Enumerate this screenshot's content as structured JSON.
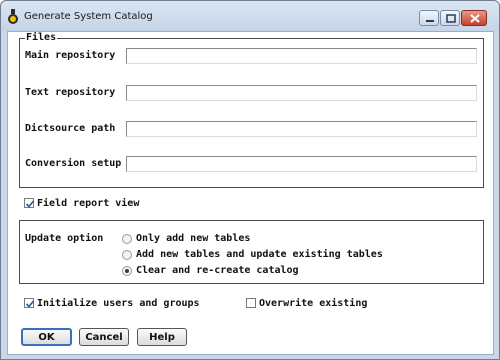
{
  "window": {
    "title": "Generate System Catalog",
    "icons": {
      "app": "flask-icon",
      "minimize": "minimize-icon",
      "maximize": "maximize-icon",
      "close": "close-icon"
    }
  },
  "files": {
    "legend": "Files",
    "fields": [
      {
        "label": "Main repository",
        "value": ""
      },
      {
        "label": "Text repository",
        "value": ""
      },
      {
        "label": "Dictsource path",
        "value": ""
      },
      {
        "label": "Conversion setup",
        "value": ""
      }
    ]
  },
  "field_report_view": {
    "label": "Field report view",
    "checked": true
  },
  "update_option": {
    "label": "Update option",
    "options": [
      {
        "label": "Only add new tables",
        "selected": false
      },
      {
        "label": "Add new tables and update existing tables",
        "selected": false
      },
      {
        "label": "Clear and re-create catalog",
        "selected": true
      }
    ]
  },
  "initialize_users": {
    "label": "Initialize users and groups",
    "checked": true
  },
  "overwrite_existing": {
    "label": "Overwrite existing",
    "checked": false
  },
  "buttons": {
    "ok": "OK",
    "cancel": "Cancel",
    "help": "Help"
  }
}
